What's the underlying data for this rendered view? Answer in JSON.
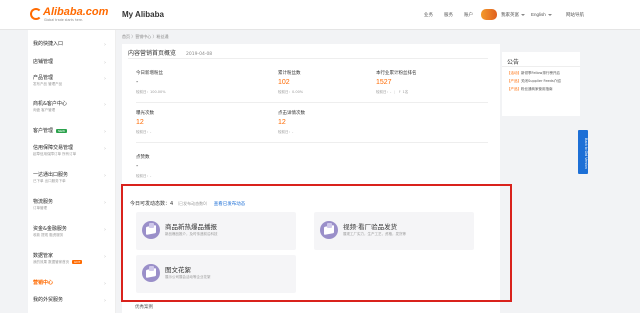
{
  "header": {
    "logo_text": "Alibaba.com",
    "logo_sub": "Global trade starts here.",
    "app_title": "My Alibaba",
    "links": [
      "业务",
      "服务",
      "账户"
    ],
    "user_name": "我家英富",
    "language": "English",
    "site_nav": "网站导航"
  },
  "sidebar": {
    "items": [
      {
        "label": "我的快捷入口",
        "sub": "",
        "badge": ""
      },
      {
        "label": "店铺管理",
        "sub": "",
        "badge": ""
      },
      {
        "label": "产品管理",
        "sub": "发布产品  管理产品",
        "badge": ""
      },
      {
        "label": "商机&客户中心",
        "sub": "询盘  客户管理",
        "badge": ""
      },
      {
        "label": "客户管理",
        "sub": "",
        "badge": "NEW"
      },
      {
        "label": "信用保障交易管理",
        "sub": "起草信用保障订单  所有订单",
        "badge": ""
      },
      {
        "label": "一达通出口服务",
        "sub": "已下单  出口服务下单",
        "badge": ""
      },
      {
        "label": "物流服务",
        "sub": "订单管理",
        "badge": ""
      },
      {
        "label": "资金&金融服务",
        "sub": "收款 提现  融资服务",
        "badge": ""
      },
      {
        "label": "数据管家",
        "sub": "我的效果  数据管家首页",
        "badge": "HOT"
      },
      {
        "label": "营销中心",
        "sub": "",
        "badge": ""
      },
      {
        "label": "我的外贸服务",
        "sub": "",
        "badge": ""
      }
    ]
  },
  "breadcrumb": "首页  〉营销中心  〉粉丝通",
  "card": {
    "title": "内容营销首页概览",
    "date": "2019-04-08",
    "metrics": [
      {
        "label": "今日新增粉丝",
        "value": "-",
        "foot_a": "较前日：100.00%",
        "foot_b": ""
      },
      {
        "label": "累计粉丝数",
        "value": "102",
        "foot_a": "较前日：0.00%",
        "foot_b": ""
      },
      {
        "label": "本行业累计粉丝排名",
        "value": "1527",
        "foot_a": "较前日：-",
        "foot_b": "↑ 1名"
      },
      {
        "label": "曝光次数",
        "value": "12",
        "foot_a": "较前日：-",
        "foot_b": ""
      },
      {
        "label": "点击详情次数",
        "value": "12",
        "foot_a": "较前日：-",
        "foot_b": ""
      },
      {
        "label": "点赞数",
        "value": "-",
        "foot_a": "较前日：-",
        "foot_b": ""
      }
    ]
  },
  "publish": {
    "heading": "今日可发动态数：4",
    "hint": "（已发布动态数0）",
    "link": "查看已发布动态",
    "cards": [
      {
        "title": "商品新热爆品播报",
        "desc": "新品爆品推介，及时传递前沿科技"
      },
      {
        "title": "视频·看厂验品发货",
        "desc": "展现工厂实力，生产工艺，资格，发货等"
      },
      {
        "title": "图文花絮",
        "desc": "展示公司展会活动等企业花絮"
      }
    ]
  },
  "bottom_label": "优秀案例",
  "notice": {
    "title": "公告",
    "items": [
      {
        "tag": "【活动】",
        "text": "新领季Fellow排行榜开启"
      },
      {
        "tag": "【产品】",
        "text": "关闭Supplier Feeds介绍"
      },
      {
        "tag": "【产品】",
        "text": "粉丝通商家使用指南"
      }
    ]
  },
  "float_button": "Back to Old Version"
}
